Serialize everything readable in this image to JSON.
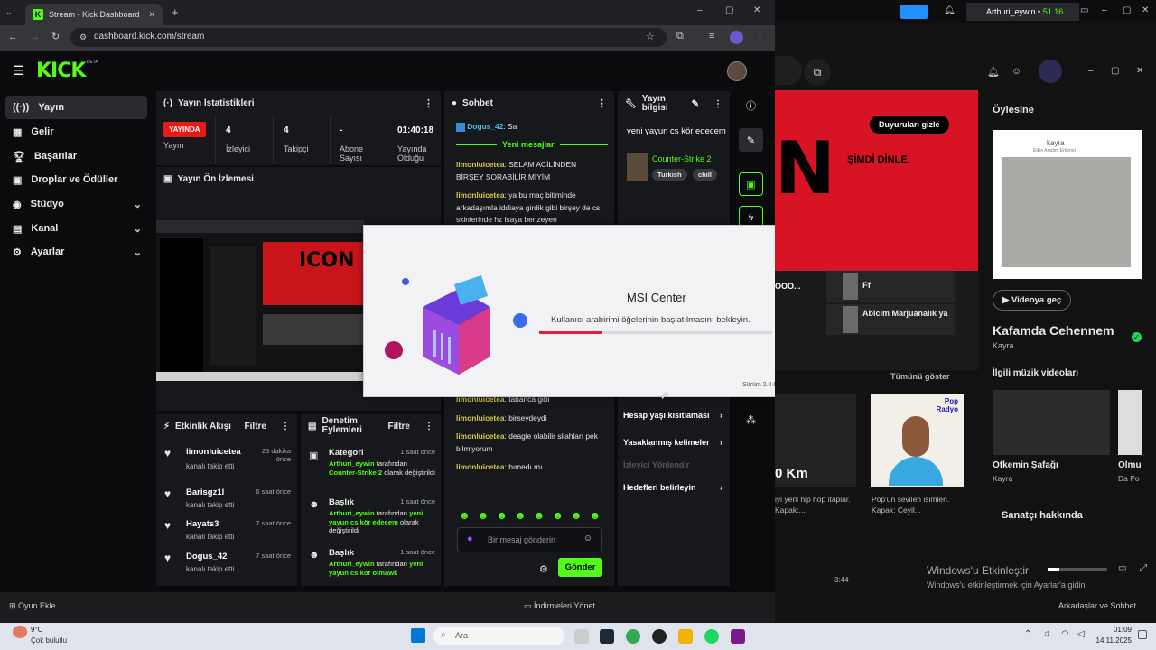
{
  "browser": {
    "tab_title": "Stream - Kick Dashboard",
    "url": "dashboard.kick.com/stream"
  },
  "kick": {
    "logo": "KICK",
    "beta": "BETA",
    "nav": [
      {
        "label": "Yayın",
        "icon": "broadcast-icon"
      },
      {
        "label": "Gelir",
        "icon": "chart-icon"
      },
      {
        "label": "Başarılar",
        "icon": "trophy-icon"
      },
      {
        "label": "Droplar ve Ödüller",
        "icon": "gift-icon"
      },
      {
        "label": "Stüdyo",
        "icon": "studio-icon"
      },
      {
        "label": "Kanal",
        "icon": "channel-icon"
      },
      {
        "label": "Ayarlar",
        "icon": "gear-icon"
      }
    ],
    "stats": {
      "title": "Yayın İstatistikleri",
      "badge": "YAYINDA",
      "badge_label": "Yayın",
      "viewers": "4",
      "viewers_label": "İzleyici",
      "followers": "4",
      "followers_label": "Takipçi",
      "subs": "-",
      "subs_label": "Abone Sayısı",
      "duration": "01:40:18",
      "duration_label": "Yayında Olduğu"
    },
    "preview_title": "Yayın Ön İzlemesi",
    "activity": {
      "title": "Etkinlik Akışı",
      "filter": "Filtre",
      "items": [
        {
          "name": "limonluicetea",
          "desc": "kanalı takip etti",
          "time": "23 dakika önce"
        },
        {
          "name": "Barisgz1l",
          "desc": "kanalı takip etti",
          "time": "6 saat önce"
        },
        {
          "name": "Hayats3",
          "desc": "kanalı takip etti",
          "time": "7 saat önce"
        },
        {
          "name": "Dogus_42",
          "desc": "kanalı takip etti",
          "time": "7 saat önce"
        }
      ]
    },
    "moderation": {
      "title": "Denetim Eylemleri",
      "filter": "Filtre",
      "items": [
        {
          "title": "Kategori",
          "time": "1 saat önce",
          "user": "Arthuri_eywin",
          "text1": "tarafından",
          "highlight": "Counter-Strike 2",
          "text2": "olarak değiştirildi"
        },
        {
          "title": "Başlık",
          "time": "1 saat önce",
          "user": "Arthuri_eywin",
          "text1": "tarafından",
          "highlight": "yeni yayun cs kör edecem",
          "text2": "olarak değiştirildi"
        },
        {
          "title": "Başlık",
          "time": "1 saat önce",
          "user": "Arthuri_eywin",
          "text1": "tarafından",
          "highlight": "yeni yayun cs kör olmawk",
          "text2": ""
        }
      ]
    },
    "chat": {
      "title": "Sohbet",
      "first_user": "Dogus_42",
      "first_msg": "Sa",
      "new_messages": "Yeni mesajlar",
      "messages": [
        {
          "user": "limonluicetea",
          "msg": "SELAM ACİLİNDEN BİRŞEY SORABİLİR MİYİM"
        },
        {
          "user": "limonluicetea",
          "msg": "ya bu maç bitiminde arkadaşımla iddiaya girdik gibi birşey de cs skinlerinde hz isaya benzeyen"
        },
        {
          "user": "limonluicetea",
          "msg": "tabanca gibi"
        },
        {
          "user": "limonluicetea",
          "msg": "birseydeydi"
        },
        {
          "user": "limonluicetea",
          "msg": "deagle olabilir silahları pek bilmiyorum"
        },
        {
          "user": "limonluicetea",
          "msg": "bımedı mı"
        }
      ],
      "placeholder": "Bir mesaj gönderin",
      "send": "Gönder"
    },
    "info": {
      "title": "Yayın bilgisi",
      "stream_title": "yeni yayun cs kör edecem",
      "category": "Counter-Strike 2",
      "tags": [
        "Turkish",
        "chill"
      ],
      "links": [
        "Hesap yaşı kısıtlaması",
        "Yasaklanmış kelimeler",
        "İzleyici Yönlendir",
        "Hedefleri belirleyin"
      ]
    }
  },
  "dialog": {
    "title": "MSI Center",
    "message": "Kullanıcı arabirimi öğelerinin başlatılmasını bekleyin.",
    "progress": 0.27,
    "version": "Sürüm 2.0.61.0"
  },
  "status_bar": {
    "left": "Oyun Ekle",
    "center": "İndirmeleri Yönet",
    "right": "Arkadaşlar ve Sohbet"
  },
  "spotify": {
    "user": "Arthuri_eywin",
    "amount": "51.16",
    "banner_btn": "Duyuruları gizle",
    "banner_text": "ŞİMDİ DİNLE.",
    "big_letter": "N",
    "side_title": "Öylesine",
    "album_artist": "kayra",
    "album_subtitle": "Etkin Aradım Erkenol",
    "video_btn": "Videoya geç",
    "song": "Kafamda Cehennem",
    "artist": "Kayra",
    "videos_title": "İlgili müzik videoları",
    "show_all": "Tümünü göster",
    "list_items": [
      {
        "title": "Ff"
      },
      {
        "title": "Abicim Marjuanalık ya"
      }
    ],
    "left_tile_label": "OOO...",
    "km_label": "0 Km",
    "km_desc": "iyi yerli hip hop itaplar. Kapak:...",
    "radio_label": "Pop Radyo",
    "radio_desc": "Pop'un sevilen isimleri. Kapak: Ceyil...",
    "video1_title": "Öfkemin Şafağı",
    "video1_artist": "Kayra",
    "video2_title": "Olmu",
    "video2_artist": "Da Po",
    "about": "Sanatçı hakkında",
    "time": "3:44",
    "watermark1": "Windows'u Etkinleştir",
    "watermark2": "Windows'u etkinleştirmek için Ayarlar'a gidin."
  },
  "taskbar": {
    "weather_temp": "9°C",
    "weather_desc": "Çok bulutlu",
    "search": "Ara",
    "time": "01:09",
    "date": "14.11.2025"
  }
}
